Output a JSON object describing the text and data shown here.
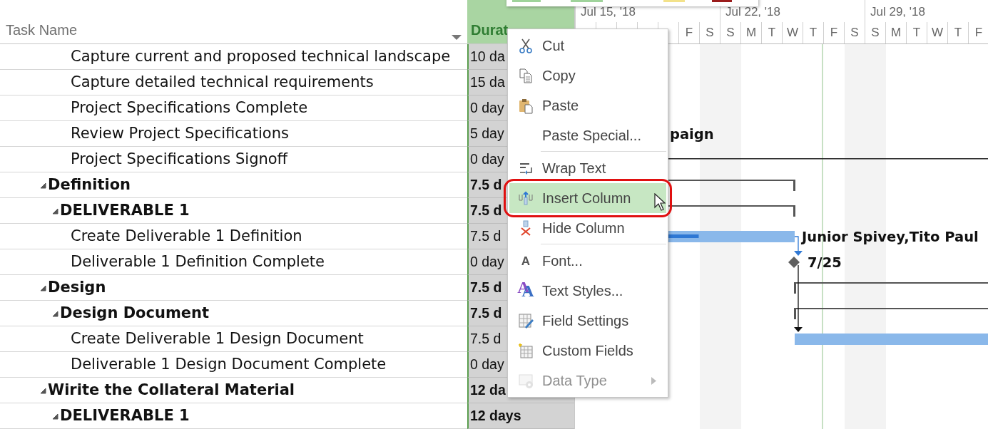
{
  "header": {
    "task_name": "Task Name",
    "duration": "Durat"
  },
  "rows_continued": [
    {
      "name": "Capture current and proposed technical landscape",
      "duration": "10 da"
    },
    {
      "name": "Capture detailed technical requirements",
      "duration": "15 da"
    },
    {
      "name": "Project Specifications Complete",
      "duration": "0 day"
    },
    {
      "name": "Review Project Specifications",
      "duration": "5 day"
    },
    {
      "name": "Project Specifications Signoff",
      "duration": "0 day"
    }
  ],
  "outline": [
    {
      "name": "Definition",
      "duration": "7.5 d",
      "expanded": true,
      "children": [
        {
          "name": "DELIVERABLE 1",
          "duration": "7.5 d",
          "expanded": true,
          "children": [
            {
              "name": "Create Deliverable 1 Definition",
              "duration": "7.5 d"
            },
            {
              "name": "Deliverable 1 Definition Complete",
              "duration": "0 day"
            }
          ]
        }
      ]
    },
    {
      "name": "Design",
      "duration": "7.5 d",
      "expanded": true,
      "children": [
        {
          "name": "Design Document",
          "duration": "7.5 d",
          "expanded": true,
          "children": [
            {
              "name": "Create Deliverable 1 Design Document",
              "duration": "7.5 d"
            },
            {
              "name": "Deliverable 1 Design Document Complete",
              "duration": "0 day"
            }
          ]
        }
      ]
    },
    {
      "name": "Wirite the Collateral Material",
      "duration": "12 da",
      "expanded": true,
      "children": [
        {
          "name": "DELIVERABLE 1",
          "duration": "12 days",
          "expanded": true
        }
      ]
    }
  ],
  "timescale": [
    {
      "label": "Jul 15, '18",
      "days": [
        {
          "letter": "F",
          "nonworking": false
        },
        {
          "letter": "S",
          "nonworking": true
        }
      ]
    },
    {
      "label": "Jul 22, '18",
      "days": [
        {
          "letter": "S",
          "nonworking": true
        },
        {
          "letter": "M",
          "nonworking": false
        },
        {
          "letter": "T",
          "nonworking": false
        },
        {
          "letter": "W",
          "nonworking": false
        },
        {
          "letter": "T",
          "nonworking": false
        },
        {
          "letter": "F",
          "nonworking": false
        },
        {
          "letter": "S",
          "nonworking": true
        }
      ]
    },
    {
      "label": "Jul 29, '18",
      "days": [
        {
          "letter": "S",
          "nonworking": true
        },
        {
          "letter": "M",
          "nonworking": false
        },
        {
          "letter": "T",
          "nonworking": false
        },
        {
          "letter": "W",
          "nonworking": false
        },
        {
          "letter": "T",
          "nonworking": false
        },
        {
          "letter": "F",
          "nonworking": false
        }
      ]
    }
  ],
  "gantt": [
    {
      "kind": "label",
      "text": "paign"
    },
    {
      "kind": "project_line"
    },
    {
      "kind": "summary"
    },
    {
      "kind": "summary"
    },
    {
      "kind": "task",
      "level": 0.24,
      "resource": "Junior Spivey,Tito Paul"
    },
    {
      "kind": "milestone",
      "date": "7/25"
    },
    {
      "kind": "summary"
    },
    {
      "kind": "summary"
    },
    {
      "kind": "task"
    }
  ],
  "context_menu": [
    {
      "kind": "item",
      "label": "Cut",
      "selected": false,
      "disabled": false
    },
    {
      "kind": "item",
      "label": "Copy",
      "selected": false,
      "disabled": false
    },
    {
      "kind": "item",
      "label": "Paste",
      "selected": false,
      "disabled": false
    },
    {
      "kind": "item",
      "label": "Paste Special...",
      "selected": false,
      "disabled": false
    },
    {
      "kind": "separator"
    },
    {
      "kind": "item",
      "label": "Wrap Text",
      "selected": false,
      "disabled": false
    },
    {
      "kind": "item",
      "label": "Insert Column",
      "selected": true,
      "disabled": false,
      "callout": true
    },
    {
      "kind": "item",
      "label": "Hide Column",
      "selected": false,
      "disabled": false
    },
    {
      "kind": "separator"
    },
    {
      "kind": "item",
      "label": "Font...",
      "selected": false,
      "disabled": false,
      "glyph": "A"
    },
    {
      "kind": "item",
      "label": "Text Styles...",
      "selected": false,
      "disabled": false,
      "glyph": "A"
    },
    {
      "kind": "item",
      "label": "Field Settings",
      "selected": false,
      "disabled": false
    },
    {
      "kind": "item",
      "label": "Custom Fields",
      "selected": false,
      "disabled": false
    },
    {
      "kind": "item",
      "label": "Data Type",
      "selected": false,
      "disabled": true,
      "submenu": true
    }
  ]
}
